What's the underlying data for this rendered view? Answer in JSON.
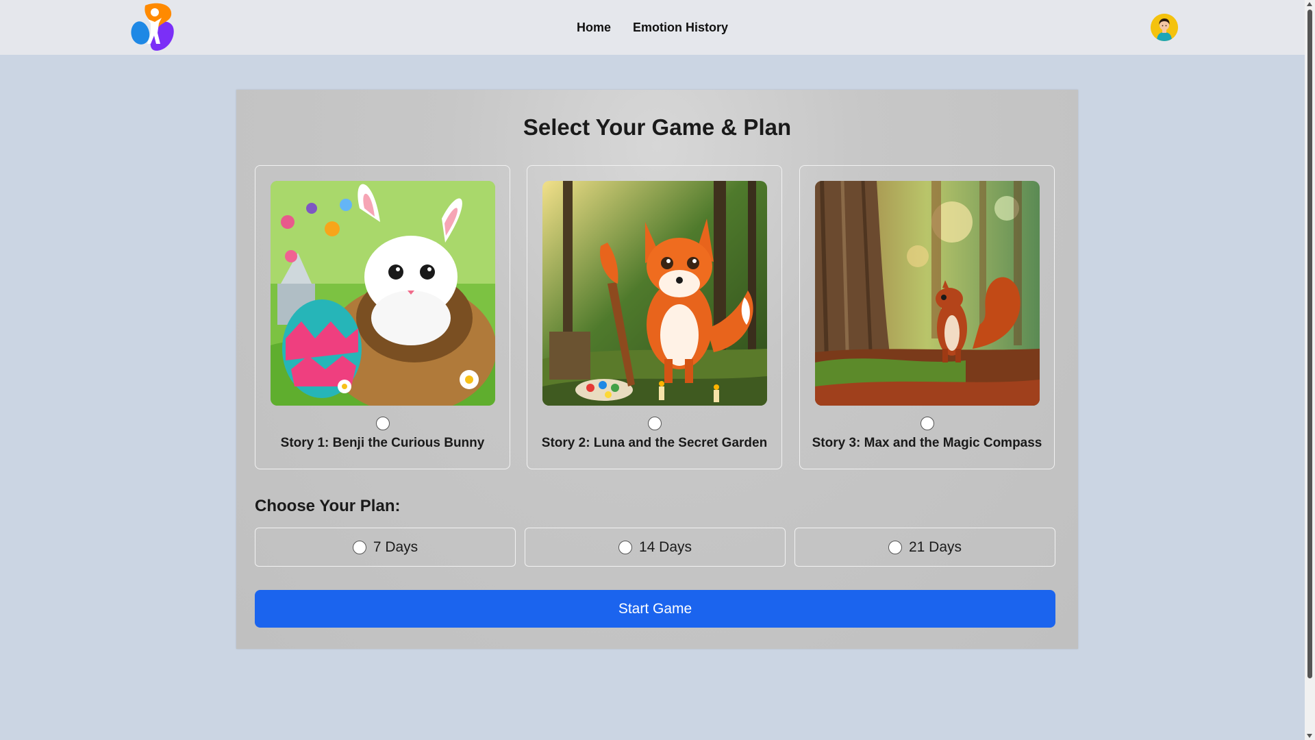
{
  "navbar": {
    "logo_icon": "kid-figure-logo-icon",
    "links": [
      "Home",
      "Emotion History"
    ],
    "avatar_icon": "user-avatar-icon"
  },
  "main": {
    "title": "Select Your Game & Plan",
    "stories": [
      {
        "label": "Story 1: Benji the Curious Bunny",
        "image": "bunny-easter-egg-image",
        "selected": false
      },
      {
        "label": "Story 2: Luna and the Secret Garden",
        "image": "fox-painter-forest-image",
        "selected": false
      },
      {
        "label": "Story 3: Max and the Magic Compass",
        "image": "squirrel-forest-image",
        "selected": false
      }
    ],
    "plan_heading": "Choose Your Plan:",
    "plans": [
      {
        "label": "7 Days",
        "selected": false
      },
      {
        "label": "14 Days",
        "selected": false
      },
      {
        "label": "21 Days",
        "selected": false
      }
    ],
    "start_label": "Start Game"
  },
  "colors": {
    "page_background": "#cbd5e3",
    "navbar": "#e5e7ec",
    "panel": "#c4c4c4",
    "primary_button": "#1b64ee",
    "avatar": "#f4c20d"
  }
}
